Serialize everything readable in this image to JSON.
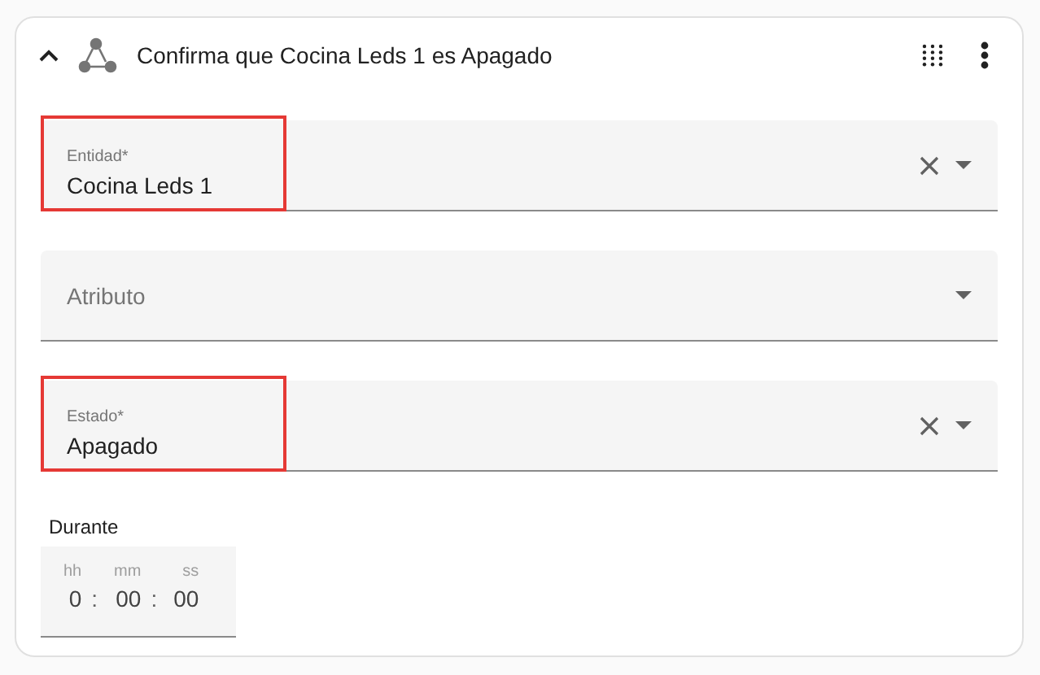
{
  "header": {
    "title": "Confirma que Cocina Leds 1 es Apagado",
    "expanded": true
  },
  "fields": [
    {
      "label": "Entidad*",
      "value": "Cocina Leds 1",
      "clearable": true,
      "highlighted": true
    },
    {
      "placeholder": "Atributo",
      "clearable": false,
      "highlighted": false
    },
    {
      "label": "Estado*",
      "value": "Apagado",
      "clearable": true,
      "highlighted": true
    }
  ],
  "duration": {
    "label": "Durante",
    "units": [
      "hh",
      "mm",
      "ss"
    ],
    "values": [
      "0",
      "00",
      "00"
    ],
    "separator": ":"
  }
}
